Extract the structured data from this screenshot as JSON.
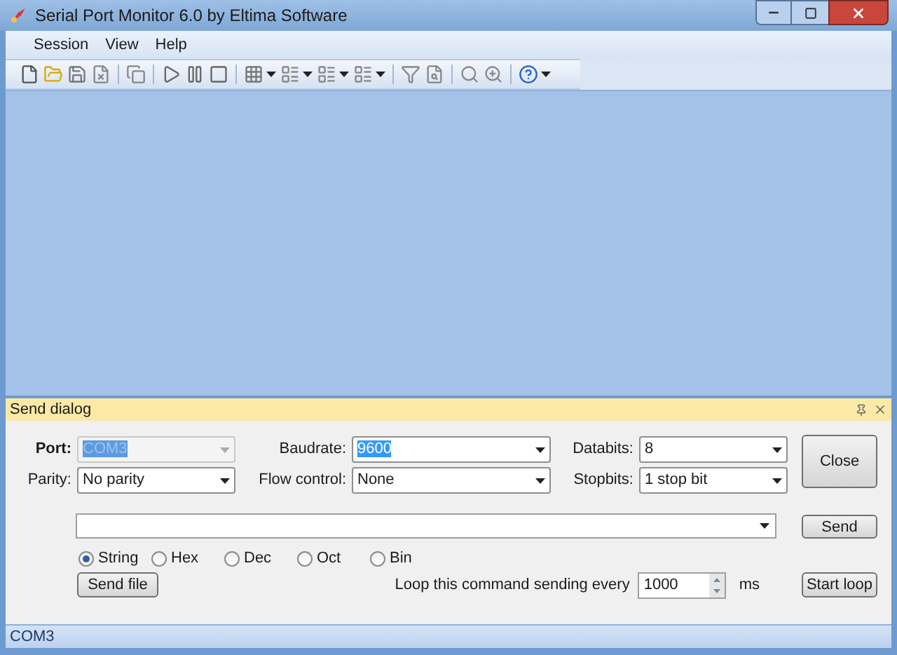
{
  "window": {
    "title": "Serial Port Monitor 6.0 by Eltima Software"
  },
  "menu": [
    "Session",
    "View",
    "Help"
  ],
  "toolbar": [
    {
      "kind": "new"
    },
    {
      "kind": "open"
    },
    {
      "kind": "save"
    },
    {
      "kind": "close-doc"
    },
    {
      "kind": "sep"
    },
    {
      "kind": "copy"
    },
    {
      "kind": "sep"
    },
    {
      "kind": "play"
    },
    {
      "kind": "pause"
    },
    {
      "kind": "stop"
    },
    {
      "kind": "sep"
    },
    {
      "kind": "grid",
      "dropdown": true
    },
    {
      "kind": "list",
      "dropdown": true
    },
    {
      "kind": "list",
      "dropdown": true
    },
    {
      "kind": "list",
      "dropdown": true
    },
    {
      "kind": "sep"
    },
    {
      "kind": "filter"
    },
    {
      "kind": "doc"
    },
    {
      "kind": "sep"
    },
    {
      "kind": "search"
    },
    {
      "kind": "search-next"
    },
    {
      "kind": "sep"
    },
    {
      "kind": "help",
      "dropdown": true
    }
  ],
  "send_dialog": {
    "title": "Send dialog",
    "fields": [
      {
        "label": "Port:",
        "value": "COM3",
        "disabled": true,
        "highlighted": true,
        "bold_label": true
      },
      {
        "label": "Baudrate:",
        "value": "9600",
        "disabled": false,
        "highlighted": true,
        "bold_label": false
      },
      {
        "label": "Databits:",
        "value": "8",
        "disabled": false,
        "highlighted": false,
        "bold_label": false
      },
      {
        "label": "Parity:",
        "value": "No parity",
        "disabled": false,
        "highlighted": false,
        "bold_label": false
      },
      {
        "label": "Flow control:",
        "value": "None",
        "disabled": false,
        "highlighted": false,
        "bold_label": false
      },
      {
        "label": "Stopbits:",
        "value": "1 stop bit",
        "disabled": false,
        "highlighted": false,
        "bold_label": false
      }
    ],
    "close_button": "Close",
    "send_button": "Send",
    "formats": [
      {
        "label": "String",
        "selected": true
      },
      {
        "label": "Hex",
        "selected": false
      },
      {
        "label": "Dec",
        "selected": false
      },
      {
        "label": "Oct",
        "selected": false
      },
      {
        "label": "Bin",
        "selected": false
      }
    ],
    "send_file_button": "Send file",
    "loop_label": "Loop this command sending every",
    "loop_interval": "1000",
    "loop_unit": "ms",
    "start_loop_button": "Start loop"
  },
  "status_bar": {
    "text": "COM3"
  }
}
